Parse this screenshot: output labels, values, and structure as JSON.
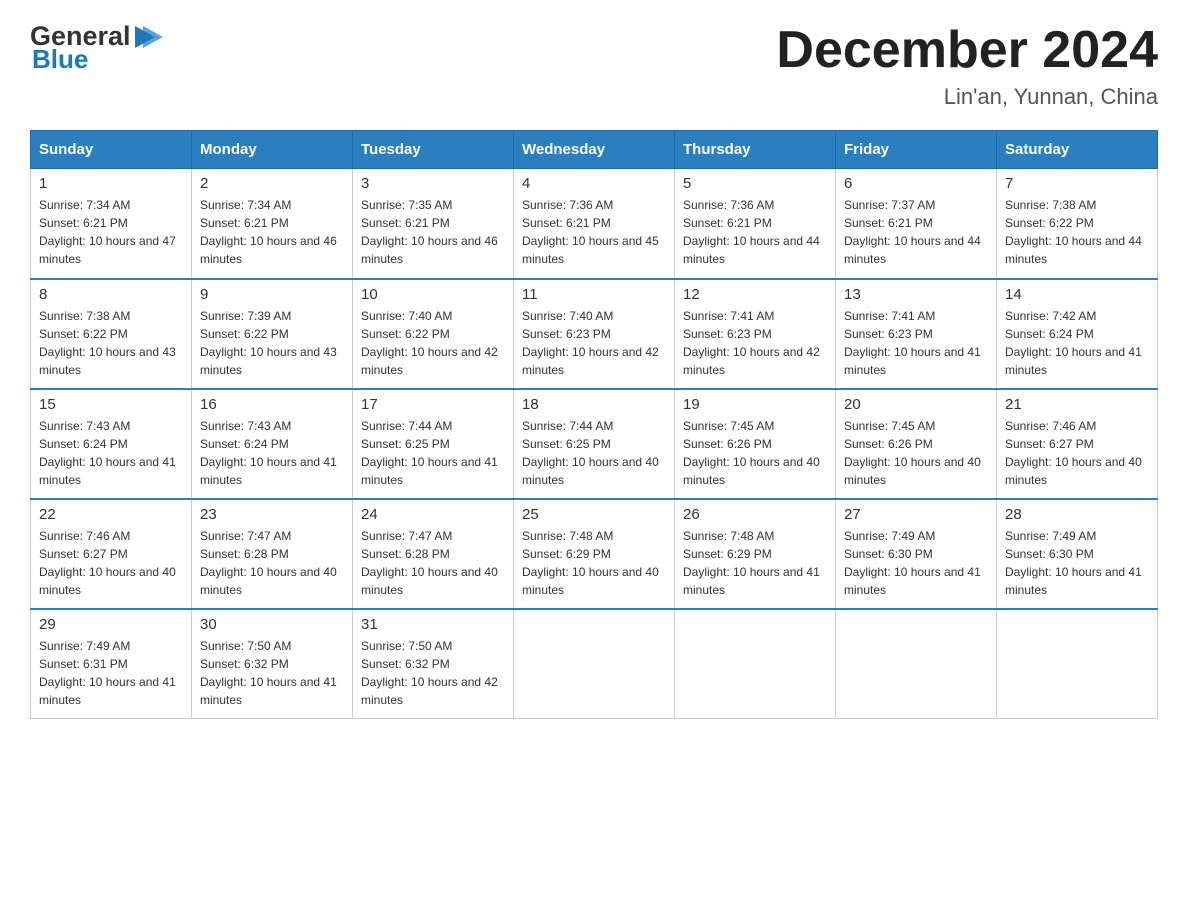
{
  "logo": {
    "text_general": "General",
    "text_blue": "Blue",
    "arrow": "▶"
  },
  "header": {
    "title": "December 2024",
    "subtitle": "Lin'an, Yunnan, China"
  },
  "weekdays": [
    "Sunday",
    "Monday",
    "Tuesday",
    "Wednesday",
    "Thursday",
    "Friday",
    "Saturday"
  ],
  "weeks": [
    [
      {
        "day": "1",
        "sunrise": "7:34 AM",
        "sunset": "6:21 PM",
        "daylight": "10 hours and 47 minutes."
      },
      {
        "day": "2",
        "sunrise": "7:34 AM",
        "sunset": "6:21 PM",
        "daylight": "10 hours and 46 minutes."
      },
      {
        "day": "3",
        "sunrise": "7:35 AM",
        "sunset": "6:21 PM",
        "daylight": "10 hours and 46 minutes."
      },
      {
        "day": "4",
        "sunrise": "7:36 AM",
        "sunset": "6:21 PM",
        "daylight": "10 hours and 45 minutes."
      },
      {
        "day": "5",
        "sunrise": "7:36 AM",
        "sunset": "6:21 PM",
        "daylight": "10 hours and 44 minutes."
      },
      {
        "day": "6",
        "sunrise": "7:37 AM",
        "sunset": "6:21 PM",
        "daylight": "10 hours and 44 minutes."
      },
      {
        "day": "7",
        "sunrise": "7:38 AM",
        "sunset": "6:22 PM",
        "daylight": "10 hours and 44 minutes."
      }
    ],
    [
      {
        "day": "8",
        "sunrise": "7:38 AM",
        "sunset": "6:22 PM",
        "daylight": "10 hours and 43 minutes."
      },
      {
        "day": "9",
        "sunrise": "7:39 AM",
        "sunset": "6:22 PM",
        "daylight": "10 hours and 43 minutes."
      },
      {
        "day": "10",
        "sunrise": "7:40 AM",
        "sunset": "6:22 PM",
        "daylight": "10 hours and 42 minutes."
      },
      {
        "day": "11",
        "sunrise": "7:40 AM",
        "sunset": "6:23 PM",
        "daylight": "10 hours and 42 minutes."
      },
      {
        "day": "12",
        "sunrise": "7:41 AM",
        "sunset": "6:23 PM",
        "daylight": "10 hours and 42 minutes."
      },
      {
        "day": "13",
        "sunrise": "7:41 AM",
        "sunset": "6:23 PM",
        "daylight": "10 hours and 41 minutes."
      },
      {
        "day": "14",
        "sunrise": "7:42 AM",
        "sunset": "6:24 PM",
        "daylight": "10 hours and 41 minutes."
      }
    ],
    [
      {
        "day": "15",
        "sunrise": "7:43 AM",
        "sunset": "6:24 PM",
        "daylight": "10 hours and 41 minutes."
      },
      {
        "day": "16",
        "sunrise": "7:43 AM",
        "sunset": "6:24 PM",
        "daylight": "10 hours and 41 minutes."
      },
      {
        "day": "17",
        "sunrise": "7:44 AM",
        "sunset": "6:25 PM",
        "daylight": "10 hours and 41 minutes."
      },
      {
        "day": "18",
        "sunrise": "7:44 AM",
        "sunset": "6:25 PM",
        "daylight": "10 hours and 40 minutes."
      },
      {
        "day": "19",
        "sunrise": "7:45 AM",
        "sunset": "6:26 PM",
        "daylight": "10 hours and 40 minutes."
      },
      {
        "day": "20",
        "sunrise": "7:45 AM",
        "sunset": "6:26 PM",
        "daylight": "10 hours and 40 minutes."
      },
      {
        "day": "21",
        "sunrise": "7:46 AM",
        "sunset": "6:27 PM",
        "daylight": "10 hours and 40 minutes."
      }
    ],
    [
      {
        "day": "22",
        "sunrise": "7:46 AM",
        "sunset": "6:27 PM",
        "daylight": "10 hours and 40 minutes."
      },
      {
        "day": "23",
        "sunrise": "7:47 AM",
        "sunset": "6:28 PM",
        "daylight": "10 hours and 40 minutes."
      },
      {
        "day": "24",
        "sunrise": "7:47 AM",
        "sunset": "6:28 PM",
        "daylight": "10 hours and 40 minutes."
      },
      {
        "day": "25",
        "sunrise": "7:48 AM",
        "sunset": "6:29 PM",
        "daylight": "10 hours and 40 minutes."
      },
      {
        "day": "26",
        "sunrise": "7:48 AM",
        "sunset": "6:29 PM",
        "daylight": "10 hours and 41 minutes."
      },
      {
        "day": "27",
        "sunrise": "7:49 AM",
        "sunset": "6:30 PM",
        "daylight": "10 hours and 41 minutes."
      },
      {
        "day": "28",
        "sunrise": "7:49 AM",
        "sunset": "6:30 PM",
        "daylight": "10 hours and 41 minutes."
      }
    ],
    [
      {
        "day": "29",
        "sunrise": "7:49 AM",
        "sunset": "6:31 PM",
        "daylight": "10 hours and 41 minutes."
      },
      {
        "day": "30",
        "sunrise": "7:50 AM",
        "sunset": "6:32 PM",
        "daylight": "10 hours and 41 minutes."
      },
      {
        "day": "31",
        "sunrise": "7:50 AM",
        "sunset": "6:32 PM",
        "daylight": "10 hours and 42 minutes."
      },
      null,
      null,
      null,
      null
    ]
  ]
}
